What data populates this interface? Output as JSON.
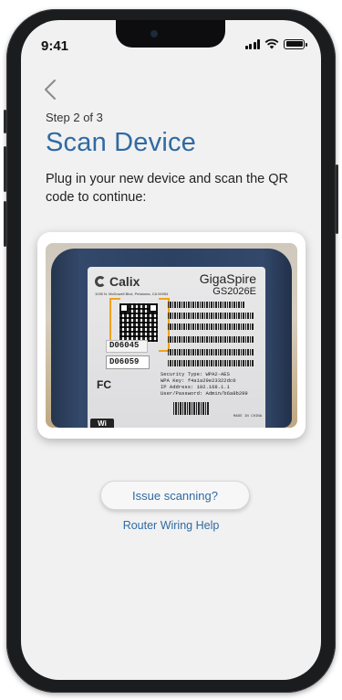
{
  "status_bar": {
    "time": "9:41"
  },
  "header": {
    "back_icon": "chevron-left-icon"
  },
  "step_label": "Step 2 of 3",
  "title": "Scan Device",
  "description": "Plug in your new device and scan the QR code to continue:",
  "photo": {
    "brand": "Calix",
    "address": "1035 N. McDowell Blvd, Petaluma, CA 94954",
    "model_name": "GigaSpire",
    "model_number": "GS2026E",
    "code_top": "D06045",
    "code_bottom": "D06059",
    "fc_mark": "FC",
    "wifi_mark": "Wi",
    "security_lines": [
      "Security Type:   WPA2-AES",
      "WPA Key:     f4a1a29e23322dc0",
      "IP Address:       192.168.1.1",
      "User/Password: Admin/b6a8b299"
    ],
    "made_in": "MADE IN CHINA"
  },
  "actions": {
    "issue_scanning": "Issue scanning?",
    "router_wiring_help": "Router Wiring Help"
  },
  "colors": {
    "accent": "#2f6aa3",
    "background": "#f1f1f1"
  }
}
